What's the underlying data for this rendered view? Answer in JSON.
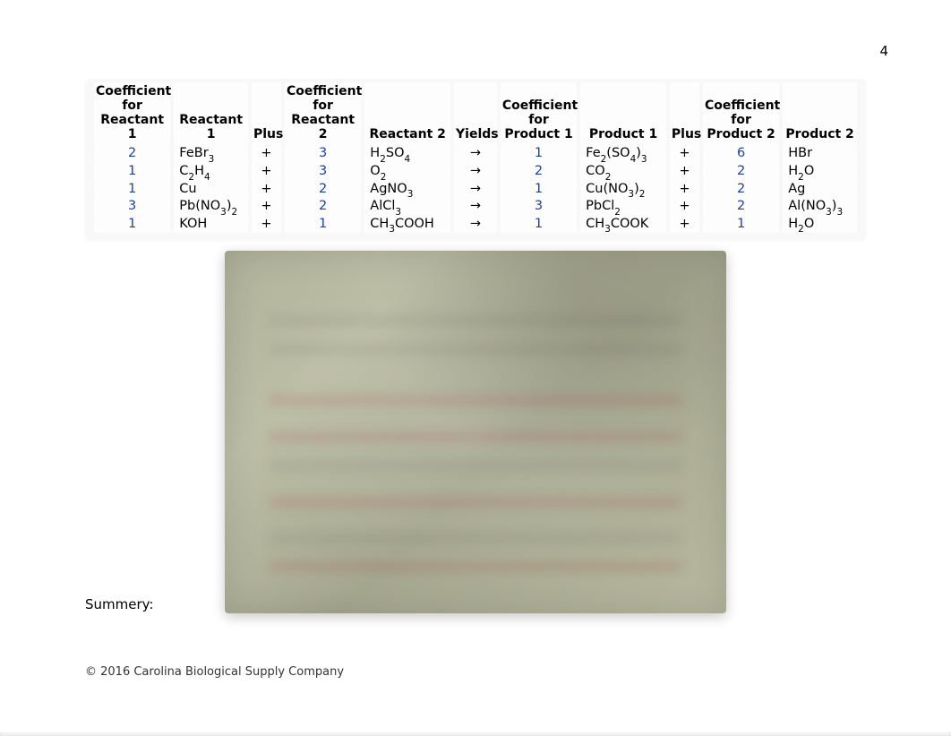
{
  "page_number": "4",
  "headers": {
    "coef_r1": "Coefficient for Reactant 1",
    "r1": "Reactant 1",
    "plus1": "Plus",
    "coef_r2": "Coefficient for Reactant 2",
    "r2": "Reactant 2",
    "yields": "Yields",
    "coef_p1": "Coefficient for Product 1",
    "p1": "Product 1",
    "plus2": "Plus",
    "coef_p2": "Coefficient for Product 2",
    "p2": "Product 2"
  },
  "symbols": {
    "plus": "+",
    "arrow": "→"
  },
  "rows": [
    {
      "cr1": "2",
      "r1": "FeBr<sub>3</sub>",
      "cr2": "3",
      "r2": "H<sub>2</sub>SO<sub>4</sub>",
      "cp1": "1",
      "p1": "Fe<sub>2</sub>(SO<sub>4</sub>)<sub>3</sub>",
      "cp2": "6",
      "p2": "HBr"
    },
    {
      "cr1": "1",
      "r1": "C<sub>2</sub>H<sub>4</sub>",
      "cr2": "3",
      "r2": "O<sub>2</sub>",
      "cp1": "2",
      "p1": "CO<sub>2</sub>",
      "cp2": "2",
      "p2": "H<sub>2</sub>O"
    },
    {
      "cr1": "1",
      "r1": "Cu",
      "cr2": "2",
      "r2": "AgNO<sub>3</sub>",
      "cp1": "1",
      "p1": "Cu(NO<sub>3</sub>)<sub>2</sub>",
      "cp2": "2",
      "p2": "Ag"
    },
    {
      "cr1": "3",
      "r1": "Pb(NO<sub>3</sub>)<sub>2</sub>",
      "cr2": "2",
      "r2": "AlCl<sub>3</sub>",
      "cp1": "3",
      "p1": "PbCl<sub>2</sub>",
      "cp2": "2",
      "p2": "Al(NO<sub>3</sub>)<sub>3</sub>"
    },
    {
      "cr1": "1",
      "r1": "KOH",
      "cr2": "1",
      "r2": "CH<sub>3</sub>COOH",
      "cp1": "1",
      "p1": "CH<sub>3</sub>COOK",
      "cp2": "1",
      "p2": "H<sub>2</sub>O"
    }
  ],
  "summary_label": "Summery:",
  "copyright": "© 2016 Carolina Biological Supply Company"
}
